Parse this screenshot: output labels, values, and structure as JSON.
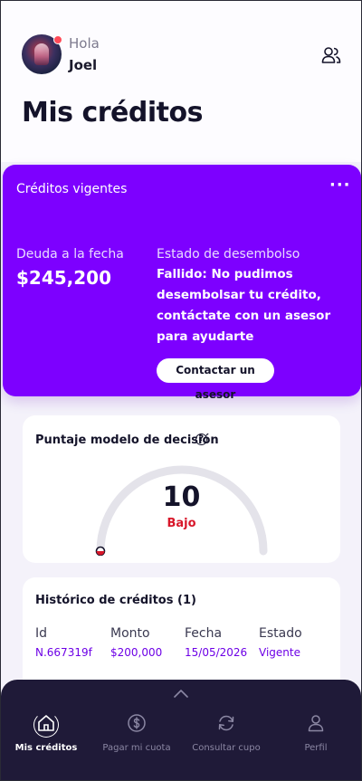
{
  "header": {
    "greeting": "Hola",
    "user_name": "Joel",
    "page_title": "Mis créditos"
  },
  "credits_card": {
    "title": "Créditos vigentes",
    "menu_icon": "more-horizontal-icon",
    "debt_label": "Deuda a la fecha",
    "debt_value": "$245,200",
    "status_label": "Estado de desembolso",
    "status_message": "Fallido: No pudimos desembolsar tu crédito, contáctate con un asesor para ayudarte",
    "contact_button": "Contactar un asesor"
  },
  "score": {
    "title": "Puntaje modelo de decisión",
    "help_icon": "?",
    "value": "10",
    "level": "Bajo",
    "gauge_fraction": 0.0
  },
  "history": {
    "title": "Histórico de créditos (1)",
    "headers": [
      "Id",
      "Monto",
      "Fecha",
      "Estado"
    ],
    "rows": [
      [
        "N.667319f",
        "$200,000",
        "15/05/2026",
        "Vigente"
      ]
    ]
  },
  "bottom_nav": {
    "items": [
      {
        "label": "Mis créditos",
        "icon": "home-icon",
        "active": true
      },
      {
        "label": "Pagar mi cuota",
        "icon": "dollar-icon",
        "active": false
      },
      {
        "label": "Consultar cupo",
        "icon": "refresh-icon",
        "active": false
      },
      {
        "label": "Perfil",
        "icon": "user-icon",
        "active": false
      }
    ]
  },
  "colors": {
    "brand": "#7d00ff",
    "nav_background": "#1f1a38",
    "score_low": "#d8172a",
    "link": "#6d00e6"
  }
}
